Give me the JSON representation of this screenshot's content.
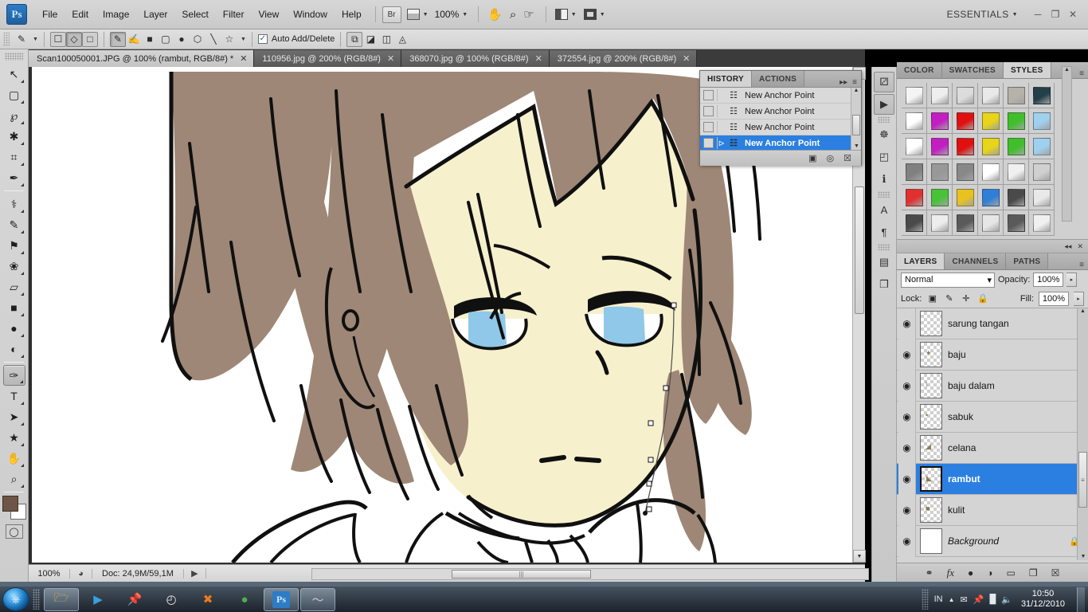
{
  "app": {
    "name": "Adobe Photoshop",
    "logo_text": "Ps",
    "workspace": "ESSENTIALS",
    "zoom_level": "100%"
  },
  "menubar": {
    "items": [
      "File",
      "Edit",
      "Image",
      "Layer",
      "Select",
      "Filter",
      "View",
      "Window",
      "Help"
    ],
    "bridge_label": "Br",
    "window_controls": [
      "─",
      "❐",
      "✕"
    ]
  },
  "optionsbar": {
    "auto_add_delete_label": "Auto Add/Delete",
    "auto_add_delete_checked": true,
    "check_glyph": "✓"
  },
  "toolbox": {
    "tools": [
      {
        "name": "move-tool",
        "glyph": "↖",
        "active": false
      },
      {
        "name": "rectangular-marquee-tool",
        "glyph": "▢",
        "active": false
      },
      {
        "name": "lasso-tool",
        "glyph": "℘",
        "active": false
      },
      {
        "name": "magic-wand-tool",
        "glyph": "✱",
        "active": false
      },
      {
        "name": "crop-tool",
        "glyph": "⌗",
        "active": false
      },
      {
        "name": "eyedropper-tool",
        "glyph": "✒",
        "active": false
      },
      {
        "name": "healing-brush-tool",
        "glyph": "⚕",
        "active": false
      },
      {
        "name": "brush-tool",
        "glyph": "✎",
        "active": false
      },
      {
        "name": "clone-stamp-tool",
        "glyph": "⚑",
        "active": false
      },
      {
        "name": "history-brush-tool",
        "glyph": "❀",
        "active": false
      },
      {
        "name": "eraser-tool",
        "glyph": "▱",
        "active": false
      },
      {
        "name": "gradient-tool",
        "glyph": "■",
        "active": false
      },
      {
        "name": "blur-tool",
        "glyph": "●",
        "active": false
      },
      {
        "name": "dodge-tool",
        "glyph": "◐",
        "active": false
      },
      {
        "name": "pen-tool",
        "glyph": "✑",
        "active": true
      },
      {
        "name": "type-tool",
        "glyph": "T",
        "active": false
      },
      {
        "name": "path-selection-tool",
        "glyph": "➤",
        "active": false
      },
      {
        "name": "custom-shape-tool",
        "glyph": "★",
        "active": false
      },
      {
        "name": "hand-tool",
        "glyph": "✋",
        "active": false
      },
      {
        "name": "zoom-tool",
        "glyph": "⌕",
        "active": false
      }
    ],
    "foreground_color": "#6d5647",
    "background_color": "#ffffff"
  },
  "tabs": [
    {
      "label": "Scan100050001.JPG @ 100% (rambut, RGB/8#) *",
      "active": true,
      "close": "✕"
    },
    {
      "label": "110956.jpg @ 200% (RGB/8#)",
      "active": false,
      "close": "✕"
    },
    {
      "label": "368070.jpg @ 100% (RGB/8#)",
      "active": false,
      "close": "✕"
    },
    {
      "label": "372554.jpg @ 200% (RGB/8#)",
      "active": false,
      "close": "✕"
    }
  ],
  "statusbar": {
    "zoom": "100%",
    "doc_info": "Doc: 24,9M/59,1M",
    "arrow": "▶",
    "left_arrow": "◀"
  },
  "history": {
    "tabs": [
      {
        "label": "HISTORY",
        "active": true
      },
      {
        "label": "ACTIONS",
        "active": false
      }
    ],
    "collapse_glyph": "▸▸",
    "menu_glyph": "≡",
    "items": [
      {
        "label": "New Anchor Point",
        "selected": false
      },
      {
        "label": "New Anchor Point",
        "selected": false
      },
      {
        "label": "New Anchor Point",
        "selected": false
      },
      {
        "label": "New Anchor Point",
        "selected": true
      }
    ],
    "footer_icons": [
      "▣",
      "◎",
      "☒"
    ]
  },
  "dockrail": {
    "icons": [
      {
        "name": "mini-bridge-icon",
        "glyph": "⚂",
        "framed": true
      },
      {
        "name": "play-icon",
        "glyph": "▶",
        "framed": true
      },
      {
        "name": "navigator-icon",
        "glyph": "☸",
        "framed": false
      },
      {
        "name": "histogram-icon",
        "glyph": "◰",
        "framed": false
      },
      {
        "name": "info-icon",
        "glyph": "ℹ",
        "framed": false
      },
      {
        "name": "character-icon",
        "glyph": "A",
        "framed": false
      },
      {
        "name": "paragraph-icon",
        "glyph": "¶",
        "framed": false
      },
      {
        "name": "layer-comps-icon",
        "glyph": "▤",
        "framed": false
      },
      {
        "name": "clone-source-icon",
        "glyph": "❐",
        "framed": false
      }
    ]
  },
  "styles_panel": {
    "tabs": [
      {
        "label": "COLOR",
        "active": false
      },
      {
        "label": "SWATCHES",
        "active": false
      },
      {
        "label": "STYLES",
        "active": true
      }
    ],
    "menu_glyph": "≡",
    "swatches": [
      "#f4f4f4",
      "#eeeeee",
      "#dcdcdc",
      "#e9e9e9",
      "#b6b1a9",
      "#234049",
      "#ffffff",
      "#c21ec2",
      "#e01010",
      "#e8d418",
      "#3fbf2a",
      "#9fd0ee",
      "#ffffff",
      "#c21ec2",
      "#e01010",
      "#e8d418",
      "#3fbf2a",
      "#9fd0ee",
      "#808080",
      "#989898",
      "#888888",
      "#ffffff",
      "#f0f0f0",
      "#d0d0d0",
      "#e03030",
      "#49c23a",
      "#e8c220",
      "#2f7fd8",
      "#4a4a4a",
      "#e9e9e9",
      "#4a4a4a",
      "#ededed",
      "#5a5a5a",
      "#e6e6e6",
      "#5a5a5a",
      "#f0f0f0"
    ],
    "footer_icons": [
      "◂◂",
      "✕"
    ]
  },
  "layers_panel": {
    "tabs": [
      {
        "label": "LAYERS",
        "active": true
      },
      {
        "label": "CHANNELS",
        "active": false
      },
      {
        "label": "PATHS",
        "active": false
      }
    ],
    "menu_glyph": "≡",
    "blend_mode": "Normal",
    "blend_caret": "▾",
    "opacity_label": "Opacity:",
    "opacity_value": "100%",
    "fill_label": "Fill:",
    "fill_value": "100%",
    "lock_label": "Lock:",
    "lock_icons": [
      "▨",
      "✐",
      "✛",
      "ὑ2"
    ],
    "spin_glyph": "▸",
    "eye_glyph": "◉",
    "lock_badge": "ὑ2",
    "layers": [
      {
        "name": "sarung tangan",
        "visible": true,
        "selected": false,
        "italic": false,
        "locked": false,
        "mark": ""
      },
      {
        "name": "baju",
        "visible": true,
        "selected": false,
        "italic": false,
        "locked": false,
        "mark": "✦"
      },
      {
        "name": "baju dalam",
        "visible": true,
        "selected": false,
        "italic": false,
        "locked": false,
        "mark": "\\"
      },
      {
        "name": "sabuk",
        "visible": true,
        "selected": false,
        "italic": false,
        "locked": false,
        "mark": "•"
      },
      {
        "name": "celana",
        "visible": true,
        "selected": false,
        "italic": false,
        "locked": false,
        "mark": "◢"
      },
      {
        "name": "rambut",
        "visible": true,
        "selected": true,
        "italic": false,
        "locked": false,
        "mark": "◣"
      },
      {
        "name": "kulit",
        "visible": true,
        "selected": false,
        "italic": false,
        "locked": false,
        "mark": "■"
      },
      {
        "name": "Background",
        "visible": true,
        "selected": false,
        "italic": true,
        "locked": true,
        "mark": ""
      }
    ],
    "footer_icons": [
      "⚭",
      "fx",
      "●",
      "◑",
      "▭",
      "❐",
      "☒"
    ]
  },
  "artwork": {
    "description": "anime character line art",
    "hair_color": "#9e8776",
    "skin_color": "#f7f0cd",
    "eye_color": "#8fc8e8",
    "line_color": "#101010"
  },
  "taskbar": {
    "apps": [
      {
        "name": "explorer",
        "glyph": "🗁",
        "open": true
      },
      {
        "name": "media-player",
        "glyph": "▶",
        "open": false
      },
      {
        "name": "pin-app",
        "glyph": "📌",
        "open": false
      },
      {
        "name": "clock-app",
        "glyph": "◴",
        "open": false
      },
      {
        "name": "xampp",
        "glyph": "✖",
        "open": false
      },
      {
        "name": "chrome",
        "glyph": "●",
        "open": false
      },
      {
        "name": "photoshop",
        "glyph": "Ps",
        "open": true
      },
      {
        "name": "swish",
        "glyph": "〜",
        "open": true
      }
    ],
    "language": "IN",
    "tray_icons": [
      "▲",
      "☰",
      "📌",
      "◥",
      "🔊"
    ],
    "time": "10:50",
    "date": "31/12/2010"
  }
}
